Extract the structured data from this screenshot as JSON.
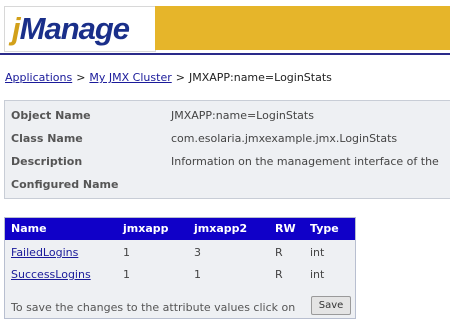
{
  "header": {
    "logo_j": "j",
    "logo_rest": "Manage",
    "colors": {
      "banner": "#e6b52a",
      "logo_text": "#1a2f8a",
      "rule": "#2a2a8a"
    }
  },
  "breadcrumb": {
    "items": [
      "Applications",
      "My JMX Cluster"
    ],
    "current": "JMXAPP:name=LoginStats",
    "separator": ">"
  },
  "info": {
    "rows": [
      {
        "label": "Object Name",
        "value": "JMXAPP:name=LoginStats"
      },
      {
        "label": "Class Name",
        "value": "com.esolaria.jmxexample.jmx.LoginStats"
      },
      {
        "label": "Description",
        "value": "Information on the management interface of the"
      },
      {
        "label": "Configured Name",
        "value": ""
      }
    ]
  },
  "attributes": {
    "columns": [
      "Name",
      "jmxapp",
      "jmxapp2",
      "RW",
      "Type"
    ],
    "rows": [
      {
        "name": "FailedLogins",
        "jmxapp": "1",
        "jmxapp2": "3",
        "rw": "R",
        "type": "int"
      },
      {
        "name": "SuccessLogins",
        "jmxapp": "1",
        "jmxapp2": "1",
        "rw": "R",
        "type": "int"
      }
    ],
    "footer_text": "To save the changes to the attribute values click on",
    "save_label": "Save",
    "header_color": "#1000c8"
  }
}
